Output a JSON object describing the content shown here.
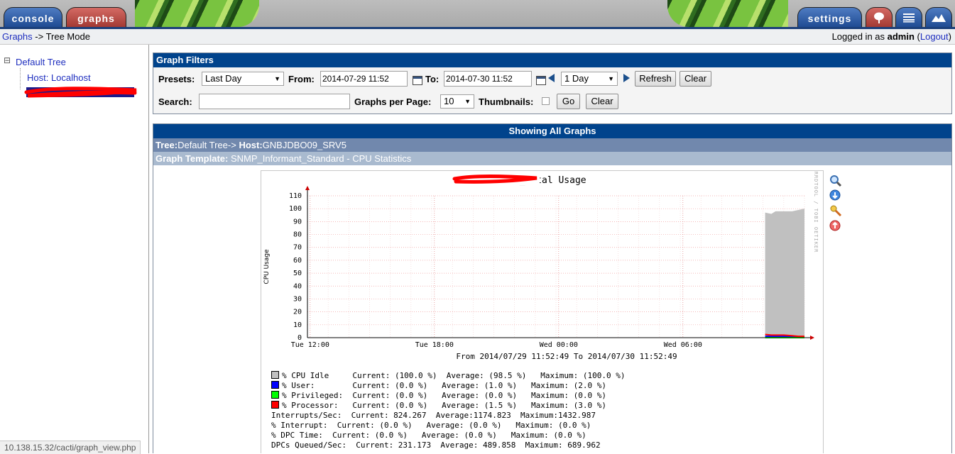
{
  "nav": {
    "tabs": [
      {
        "label": "console",
        "color": "#2a5aa6"
      },
      {
        "label": "graphs",
        "color": "#b5443d"
      },
      {
        "label": "settings",
        "color": "#2a5aa6"
      }
    ],
    "icons": [
      "tree-view-icon",
      "list-view-icon",
      "preview-view-icon"
    ]
  },
  "breadcrumb": {
    "root": "Graphs",
    "sep": " -> ",
    "current": "Tree Mode"
  },
  "login": {
    "prefix": "Logged in as ",
    "user": "admin",
    "open": " (",
    "logout": "Logout",
    "close": ")"
  },
  "tree": {
    "expander": "⊟",
    "root": "Default Tree",
    "hosts": [
      {
        "label": "Host: Localhost",
        "selected": false
      },
      {
        "label": "",
        "selected": true
      }
    ]
  },
  "filters": {
    "title": "Graph Filters",
    "presets_label": "Presets:",
    "presets_value": "Last Day",
    "from_label": "From:",
    "from_value": "2014-07-29 11:52",
    "to_label": "To:",
    "to_value": "2014-07-30 11:52",
    "span_value": "1 Day",
    "refresh": "Refresh",
    "clear": "Clear",
    "search_label": "Search:",
    "search_value": "",
    "gpp_label": "Graphs per Page:",
    "gpp_value": "10",
    "thumbs_label": "Thumbnails:",
    "thumbs_checked": false,
    "go": "Go",
    "clear2": "Clear"
  },
  "graphs": {
    "title": "Showing All Graphs",
    "tree_label": "Tree:",
    "tree_value": "Default Tree->",
    "host_label": " Host:",
    "host_value": "GNBJDBO09_SRV5",
    "template_label": "Graph Template:",
    "template_value": " SNMP_Informant_Standard - CPU Statistics"
  },
  "chart_data": {
    "type": "area",
    "title": "CPU _Total Usage",
    "ylabel": "CPU Usage",
    "watermark": "RRDTOOL / TOBI OETIKER",
    "ylim": [
      0,
      110
    ],
    "yticks": [
      0,
      10,
      20,
      30,
      40,
      50,
      60,
      70,
      80,
      90,
      100,
      110
    ],
    "x_ticks": [
      "Tue 12:00",
      "Tue 18:00",
      "Wed 00:00",
      "Wed 06:00"
    ],
    "x_tick_hours": [
      0.13,
      6.13,
      12.13,
      18.13
    ],
    "x_range_hours": [
      0,
      24
    ],
    "range_text": "From 2014/07/29 11:52:49 To 2014/07/30 11:52:49",
    "series": [
      {
        "name": "% CPU Idle",
        "color": "#c0c0c0",
        "x": [
          22.1,
          22.4,
          22.6,
          23.0,
          23.4,
          23.7,
          24.0
        ],
        "values": [
          97,
          96,
          98,
          98,
          98,
          99,
          100
        ]
      },
      {
        "name": "% User:",
        "color": "#0000ff",
        "x": [
          22.1,
          22.4,
          22.6,
          23.0,
          23.4,
          23.7,
          24.0
        ],
        "values": [
          1,
          1,
          1,
          1,
          1,
          0,
          0
        ]
      },
      {
        "name": "% Privileged:",
        "color": "#00ff00",
        "x": [
          22.1,
          24.0
        ],
        "values": [
          0,
          0
        ]
      },
      {
        "name": "% Processor:",
        "color": "#ff0000",
        "x": [
          22.1,
          22.4,
          22.6,
          23.0,
          23.4,
          23.7,
          24.0
        ],
        "values": [
          2.5,
          2,
          2,
          2,
          1.5,
          1,
          1
        ]
      }
    ],
    "legend": [
      {
        "swatch": "#c0c0c0",
        "text": "% CPU Idle     Current: (100.0 %)  Average: (98.5 %)   Maximum: (100.0 %)"
      },
      {
        "swatch": "#0000ff",
        "text": "% User:        Current: (0.0 %)   Average: (1.0 %)   Maximum: (2.0 %)"
      },
      {
        "swatch": "#00ff00",
        "text": "% Privileged:  Current: (0.0 %)   Average: (0.0 %)   Maximum: (0.0 %)"
      },
      {
        "swatch": "#ff0000",
        "text": "% Processor:   Current: (0.0 %)   Average: (1.5 %)   Maximum: (3.0 %)"
      },
      {
        "swatch": "",
        "text": "Interrupts/Sec:  Current: 824.267  Average:1174.823  Maximum:1432.987"
      },
      {
        "swatch": "",
        "text": "% Interrupt:  Current: (0.0 %)   Average: (0.0 %)   Maximum: (0.0 %)"
      },
      {
        "swatch": "",
        "text": "% DPC Time:  Current: (0.0 %)   Average: (0.0 %)   Maximum: (0.0 %)"
      },
      {
        "swatch": "",
        "text": "DPCs Queued/Sec:  Current: 231.173  Average: 489.858  Maximum: 689.962"
      }
    ]
  },
  "status": {
    "url": "10.138.15.32/cacti/graph_view.php"
  }
}
